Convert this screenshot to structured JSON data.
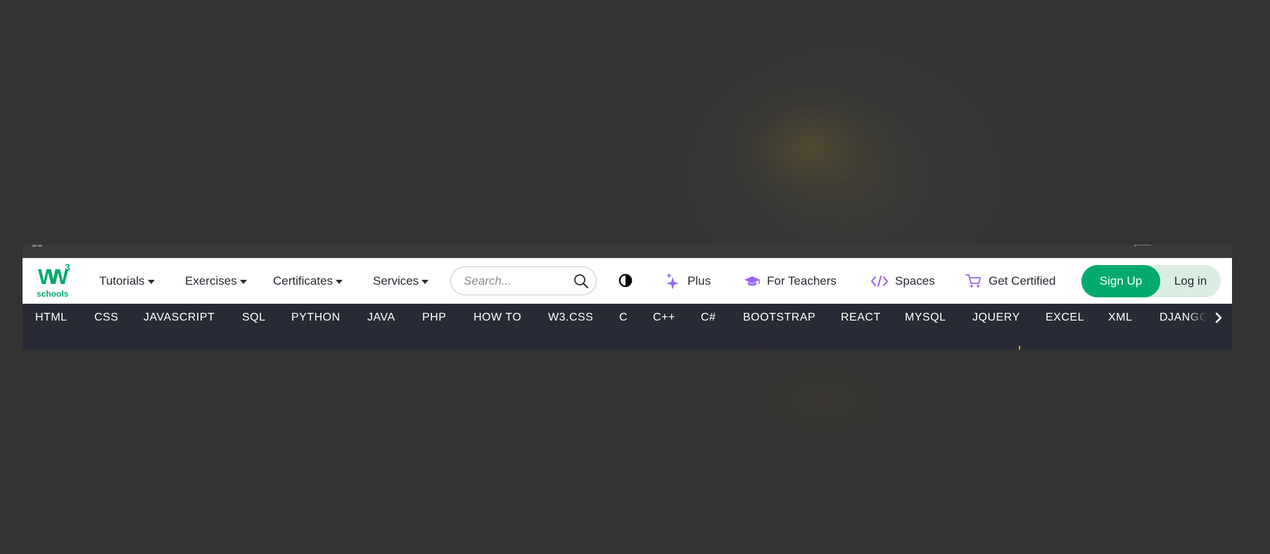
{
  "logo": {
    "mark": "W",
    "superscript": "3",
    "wordmark": "schools"
  },
  "topnav": {
    "menus": [
      {
        "label": "Tutorials"
      },
      {
        "label": "Exercises"
      },
      {
        "label": "Certificates"
      },
      {
        "label": "Services"
      }
    ],
    "search": {
      "placeholder": "Search...",
      "value": ""
    },
    "links": [
      {
        "label": "Plus",
        "icon": "sparkle-icon"
      },
      {
        "label": "For Teachers",
        "icon": "graduation-cap-icon"
      },
      {
        "label": "Spaces",
        "icon": "code-brackets-icon"
      },
      {
        "label": "Get Certified",
        "icon": "cart-icon"
      }
    ],
    "signup_label": "Sign Up",
    "login_label": "Log in"
  },
  "subnav": {
    "items": [
      "HTML",
      "CSS",
      "JAVASCRIPT",
      "SQL",
      "PYTHON",
      "JAVA",
      "PHP",
      "HOW TO",
      "W3.CSS",
      "C",
      "C++",
      "C#",
      "BOOTSTRAP",
      "REACT",
      "MYSQL",
      "JQUERY",
      "EXCEL",
      "XML",
      "DJANGO"
    ]
  },
  "colors": {
    "brand_green": "#04aa6d",
    "nav_dark": "#282a35",
    "accent_purple": "#9763f6",
    "auth_pill_bg": "#d9eee1"
  }
}
